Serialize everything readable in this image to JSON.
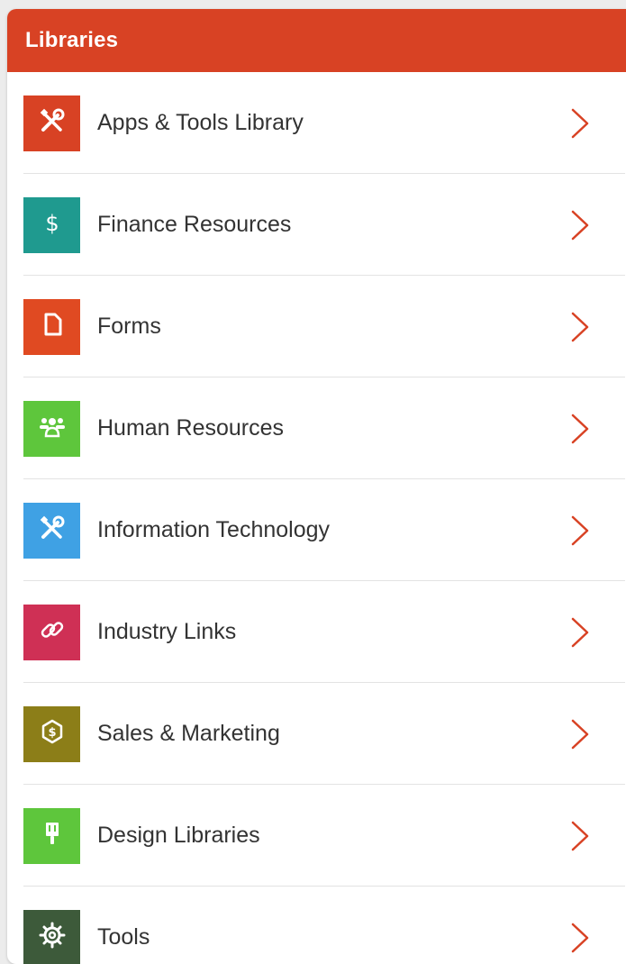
{
  "header": {
    "title": "Libraries"
  },
  "colors": {
    "header_bg": "#d84224",
    "chevron": "#d84224"
  },
  "items": [
    {
      "label": "Apps & Tools Library",
      "icon": "tools-icon",
      "color": "#d84224"
    },
    {
      "label": "Finance Resources",
      "icon": "dollar-icon",
      "color": "#1f9a8f"
    },
    {
      "label": "Forms",
      "icon": "document-icon",
      "color": "#e04a22"
    },
    {
      "label": "Human Resources",
      "icon": "people-icon",
      "color": "#5ec63c"
    },
    {
      "label": "Information Technology",
      "icon": "tools-icon",
      "color": "#3fa1e4"
    },
    {
      "label": "Industry Links",
      "icon": "link-icon",
      "color": "#cf3055"
    },
    {
      "label": "Sales & Marketing",
      "icon": "money-badge-icon",
      "color": "#8c7e18"
    },
    {
      "label": "Design Libraries",
      "icon": "paint-brush-icon",
      "color": "#5ec63c"
    },
    {
      "label": "Tools",
      "icon": "gear-icon",
      "color": "#3d5a3a"
    }
  ]
}
